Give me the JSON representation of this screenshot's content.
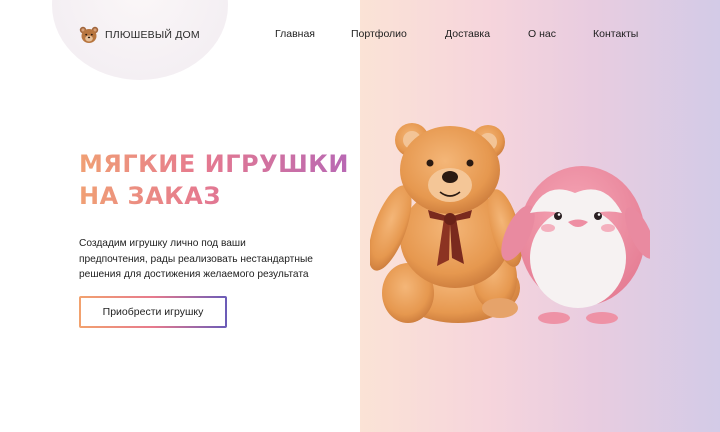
{
  "brand": {
    "name": "ПЛЮШЕВЫЙ ДОМ",
    "icon": "teddy-bear-icon"
  },
  "nav": {
    "items": [
      {
        "label": "Главная"
      },
      {
        "label": "Портфолио"
      },
      {
        "label": "Доставка"
      },
      {
        "label": "О нас"
      },
      {
        "label": "Контакты"
      }
    ]
  },
  "hero": {
    "title_line1": "МЯГКИЕ ИГРУШКИ",
    "title_line2": "НА ЗАКАЗ",
    "description_line1": "Создадим игрушку лично под ваши",
    "description_line2": "предпочтения, рады реализовать нестандартные",
    "description_line3": "решения для достижения желаемого результата",
    "cta_label": "Приобрести игрушку",
    "image_alt": "teddy-bear-and-penguin-plush"
  },
  "colors": {
    "gradient_start": "#f0a074",
    "gradient_mid": "#e67a8f",
    "gradient_end": "#b868b4",
    "panel_start": "#fbe3d6",
    "panel_end": "#d3cbe7"
  }
}
